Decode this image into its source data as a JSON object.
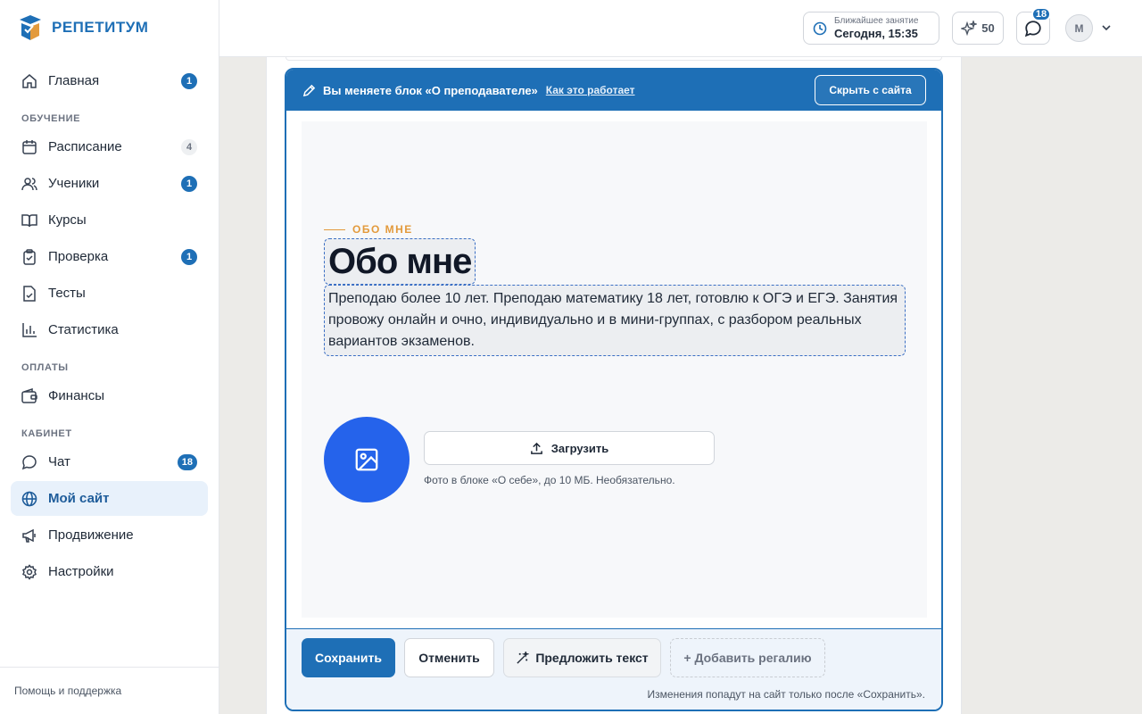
{
  "brand": {
    "name": "РЕПЕТИТУМ",
    "logo_icon": "graduation-cube-icon"
  },
  "sidebar": {
    "items": [
      {
        "id": "home",
        "label": "Главная",
        "icon": "home-icon",
        "badge": "1"
      },
      {
        "id": "schedule",
        "label": "Расписание",
        "icon": "calendar-icon",
        "badge": "4"
      },
      {
        "id": "students",
        "label": "Ученики",
        "icon": "users-icon",
        "badge": "1"
      },
      {
        "id": "courses",
        "label": "Курсы",
        "icon": "book-icon",
        "badge": ""
      },
      {
        "id": "review",
        "label": "Проверка",
        "icon": "clipboard-check-icon",
        "badge": "1"
      },
      {
        "id": "tests",
        "label": "Тесты",
        "icon": "file-check-icon",
        "badge": ""
      },
      {
        "id": "stats",
        "label": "Статистика",
        "icon": "bar-chart-icon",
        "badge": ""
      },
      {
        "id": "finance",
        "label": "Финансы",
        "icon": "wallet-icon",
        "badge": ""
      },
      {
        "id": "chat",
        "label": "Чат",
        "icon": "chat-icon",
        "badge": "18"
      },
      {
        "id": "mysite",
        "label": "Мой сайт",
        "icon": "globe-icon",
        "badge": ""
      },
      {
        "id": "promo",
        "label": "Продвижение",
        "icon": "megaphone-icon",
        "badge": ""
      },
      {
        "id": "settings",
        "label": "Настройки",
        "icon": "gear-icon",
        "badge": ""
      }
    ],
    "sections": {
      "learning": "ОБУЧЕНИЕ",
      "payments": "ОПЛАТЫ",
      "cabinet": "КАБИНЕТ"
    },
    "active": "Мой сайт",
    "footer": "Помощь и поддержка"
  },
  "header": {
    "next_lesson_label": "Ближайшее занятие",
    "next_lesson_value": "Сегодня, 15:35",
    "points": "50",
    "chat_badge": "18",
    "avatar_initial": "М"
  },
  "editor": {
    "bar_title": "Вы меняете блок «О преподавателе»",
    "how_link": "Как это работает",
    "hide_button": "Скрыть с сайта",
    "eyebrow": "ОБО МНЕ",
    "heading": "Обо мне",
    "about_text": "Преподаю более 10 лет. Преподаю математику 18 лет, готовлю к ОГЭ и ЕГЭ. Занятия провожу онлайн и очно, индивидуально и в мини-группах, с разбором реальных вариантов экзаменов.",
    "upload_label": "Загрузить",
    "upload_hint": "Фото в блоке «О себе», до 10 МБ. Необязательно.",
    "save": "Сохранить",
    "cancel": "Отменить",
    "suggest": "Предложить текст",
    "add_regalia": "+ Добавить регалию",
    "footer_note": "Изменения попадут на сайт только после «Сохранить»."
  },
  "colors": {
    "accent": "#1e6fb6",
    "eyebrow": "#e39a3c",
    "photo_circle": "#2563eb"
  }
}
